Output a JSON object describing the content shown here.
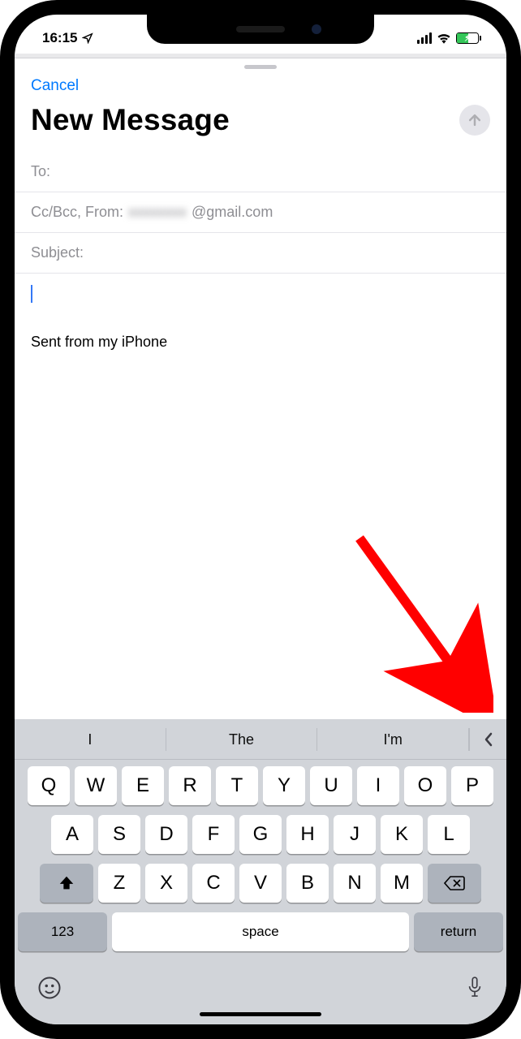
{
  "status": {
    "time": "16:15"
  },
  "sheet": {
    "cancel": "Cancel",
    "title": "New Message"
  },
  "fields": {
    "to_label": "To:",
    "cc_label": "Cc/Bcc, From:",
    "from_hidden": "xxxxxxxx",
    "from_domain": "@gmail.com",
    "subject_label": "Subject:"
  },
  "body": {
    "signature": "Sent from my iPhone"
  },
  "keyboard": {
    "predictions": [
      "I",
      "The",
      "I'm"
    ],
    "row1": [
      "Q",
      "W",
      "E",
      "R",
      "T",
      "Y",
      "U",
      "I",
      "O",
      "P"
    ],
    "row2": [
      "A",
      "S",
      "D",
      "F",
      "G",
      "H",
      "J",
      "K",
      "L"
    ],
    "row3": [
      "Z",
      "X",
      "C",
      "V",
      "B",
      "N",
      "M"
    ],
    "key_123": "123",
    "key_space": "space",
    "key_return": "return"
  }
}
